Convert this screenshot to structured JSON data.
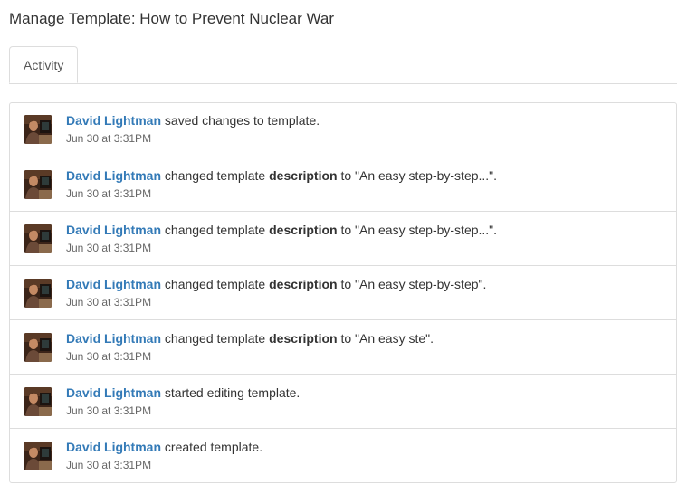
{
  "page": {
    "title": "Manage Template: How to Prevent Nuclear War"
  },
  "tabs": [
    {
      "label": "Activity",
      "active": true
    }
  ],
  "colors": {
    "link": "#337ab7",
    "text": "#333333",
    "muted": "#666666",
    "border": "#dddddd"
  },
  "activity": [
    {
      "user": "David Lightman",
      "action": " saved changes to template.",
      "field": "",
      "value_text": "",
      "timestamp": "Jun 30 at 3:31PM",
      "avatar_icon": "user-avatar-photo"
    },
    {
      "user": "David Lightman",
      "action": " changed template ",
      "field": "description",
      "value_text": " to \"An easy step-by-step...\".",
      "timestamp": "Jun 30 at 3:31PM",
      "avatar_icon": "user-avatar-photo"
    },
    {
      "user": "David Lightman",
      "action": " changed template ",
      "field": "description",
      "value_text": " to \"An easy step-by-step...\".",
      "timestamp": "Jun 30 at 3:31PM",
      "avatar_icon": "user-avatar-photo"
    },
    {
      "user": "David Lightman",
      "action": " changed template ",
      "field": "description",
      "value_text": " to \"An easy step-by-step\".",
      "timestamp": "Jun 30 at 3:31PM",
      "avatar_icon": "user-avatar-photo"
    },
    {
      "user": "David Lightman",
      "action": " changed template ",
      "field": "description",
      "value_text": " to \"An easy ste\".",
      "timestamp": "Jun 30 at 3:31PM",
      "avatar_icon": "user-avatar-photo"
    },
    {
      "user": "David Lightman",
      "action": " started editing template.",
      "field": "",
      "value_text": "",
      "timestamp": "Jun 30 at 3:31PM",
      "avatar_icon": "user-avatar-photo"
    },
    {
      "user": "David Lightman",
      "action": " created template.",
      "field": "",
      "value_text": "",
      "timestamp": "Jun 30 at 3:31PM",
      "avatar_icon": "user-avatar-photo"
    }
  ]
}
